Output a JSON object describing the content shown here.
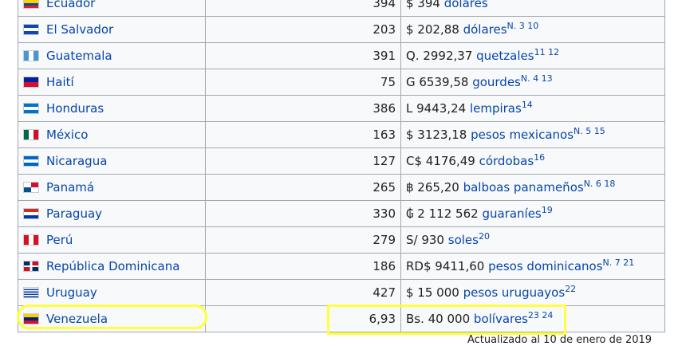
{
  "rows": [
    {
      "country": "Ecuador",
      "flag_icon": "ecuador-flag-icon",
      "value": "394",
      "currency_prefix": "$ 394",
      "currency_name": "dólares",
      "notes": ""
    },
    {
      "country": "El Salvador",
      "flag_icon": "el-salvador-flag-icon",
      "value": "203",
      "currency_prefix": "$ 202,88",
      "currency_name": "dólares",
      "notes": "N. 3 10"
    },
    {
      "country": "Guatemala",
      "flag_icon": "guatemala-flag-icon",
      "value": "391",
      "currency_prefix": "Q. 2992,37",
      "currency_name": "quetzales",
      "notes": "11 12"
    },
    {
      "country": "Haití",
      "flag_icon": "haiti-flag-icon",
      "value": "75",
      "currency_prefix": "G 6539,58",
      "currency_name": "gourdes",
      "notes": "N. 4 13"
    },
    {
      "country": "Honduras",
      "flag_icon": "honduras-flag-icon",
      "value": "386",
      "currency_prefix": "L 9443,24",
      "currency_name": "lempiras",
      "notes": "14"
    },
    {
      "country": "México",
      "flag_icon": "mexico-flag-icon",
      "value": "163",
      "currency_prefix": "$ 3123,18",
      "currency_name": "pesos mexicanos",
      "notes": "N. 5 15"
    },
    {
      "country": "Nicaragua",
      "flag_icon": "nicaragua-flag-icon",
      "value": "127",
      "currency_prefix": "C$ 4176,49",
      "currency_name": "córdobas",
      "notes": "16"
    },
    {
      "country": "Panamá",
      "flag_icon": "panama-flag-icon",
      "value": "265",
      "currency_prefix": "฿ 265,20",
      "currency_name": "balboas panameños",
      "notes": "N. 6 18"
    },
    {
      "country": "Paraguay",
      "flag_icon": "paraguay-flag-icon",
      "value": "330",
      "currency_prefix": "₲ 2 112 562",
      "currency_name": "guaraníes",
      "notes": "19"
    },
    {
      "country": "Perú",
      "flag_icon": "peru-flag-icon",
      "value": "279",
      "currency_prefix": "S/ 930",
      "currency_name": "soles",
      "notes": "20"
    },
    {
      "country": "República Dominicana",
      "flag_icon": "dominican-republic-flag-icon",
      "value": "186",
      "currency_prefix": "RD$ 9411,60",
      "currency_name": "pesos dominicanos",
      "notes": "N. 7 21"
    },
    {
      "country": "Uruguay",
      "flag_icon": "uruguay-flag-icon",
      "value": "427",
      "currency_prefix": "$ 15 000",
      "currency_name": "pesos uruguayos",
      "notes": "22"
    },
    {
      "country": "Venezuela",
      "flag_icon": "venezuela-flag-icon",
      "value": "6,93",
      "currency_prefix": "Bs. 40 000",
      "currency_name": "bolívares",
      "notes": "23 24"
    }
  ],
  "footer_text": "Actualizado al 10 de enero de 2019",
  "colors": {
    "highlight": "#ffff3a",
    "link": "#0645ad",
    "border": "#a2a9b1",
    "cell_bg": "#f8f9fa"
  }
}
